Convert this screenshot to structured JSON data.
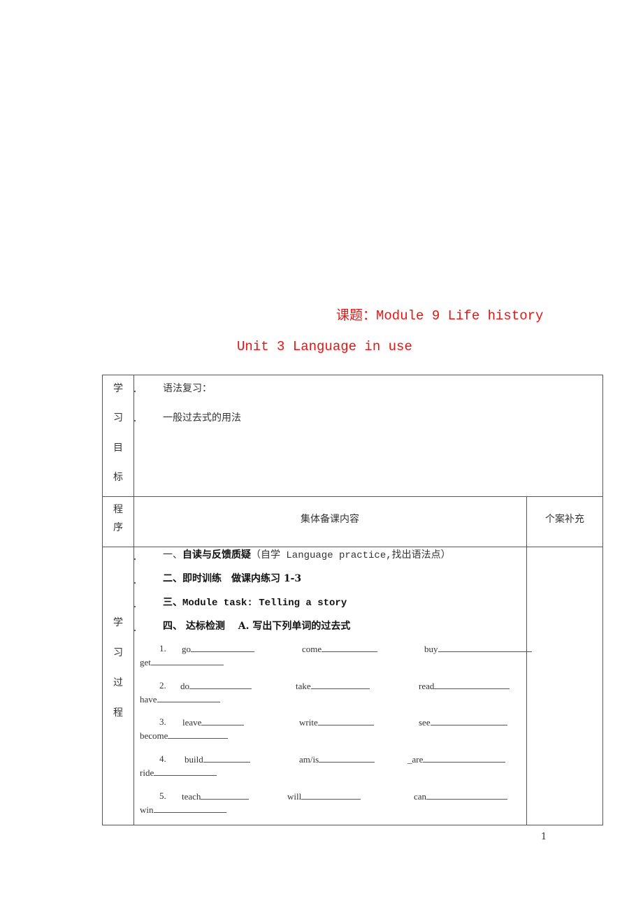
{
  "header": {
    "title_line1": "课题：Module 9 Life history",
    "title_line2": "Unit 3 Language in use",
    "title_color": "#ee1111"
  },
  "objectives": {
    "label_chars": [
      "学",
      "习",
      "目",
      "标"
    ],
    "lines": [
      "语法复习：",
      "一般过去式的用法"
    ]
  },
  "header_row": {
    "label_chars": [
      "程",
      "序"
    ],
    "main_heading": "集体备课内容",
    "side_heading": "个案补充"
  },
  "process": {
    "label_chars": [
      "学",
      "习",
      "过",
      "程"
    ],
    "steps": [
      {
        "num": "一、",
        "bold": "自读与反馈质疑",
        "rest": "（自学 Language practice,找出语法点）"
      },
      {
        "num": "二、",
        "bold": "即时训练",
        "rest": "　做课内练习 1-3"
      },
      {
        "num": "三、",
        "bold": "Module task: Telling a story",
        "rest": ""
      },
      {
        "num": "四、",
        "bold": " 达标检测　 A. 写出下列单词的过去式",
        "rest": ""
      }
    ],
    "exercises": [
      {
        "num": "1.",
        "words": [
          "go",
          "come",
          "buy",
          "get"
        ]
      },
      {
        "num": "2.",
        "words": [
          "do",
          "take",
          "read",
          "have"
        ]
      },
      {
        "num": "3.",
        "words": [
          "leave",
          "write",
          "see",
          "become"
        ]
      },
      {
        "num": "4.",
        "words": [
          "build",
          "am/is",
          "_are",
          "ride"
        ]
      },
      {
        "num": "5.",
        "words": [
          "teach",
          "will",
          "can",
          "win"
        ]
      }
    ]
  },
  "footer": {
    "page_number": "1"
  }
}
